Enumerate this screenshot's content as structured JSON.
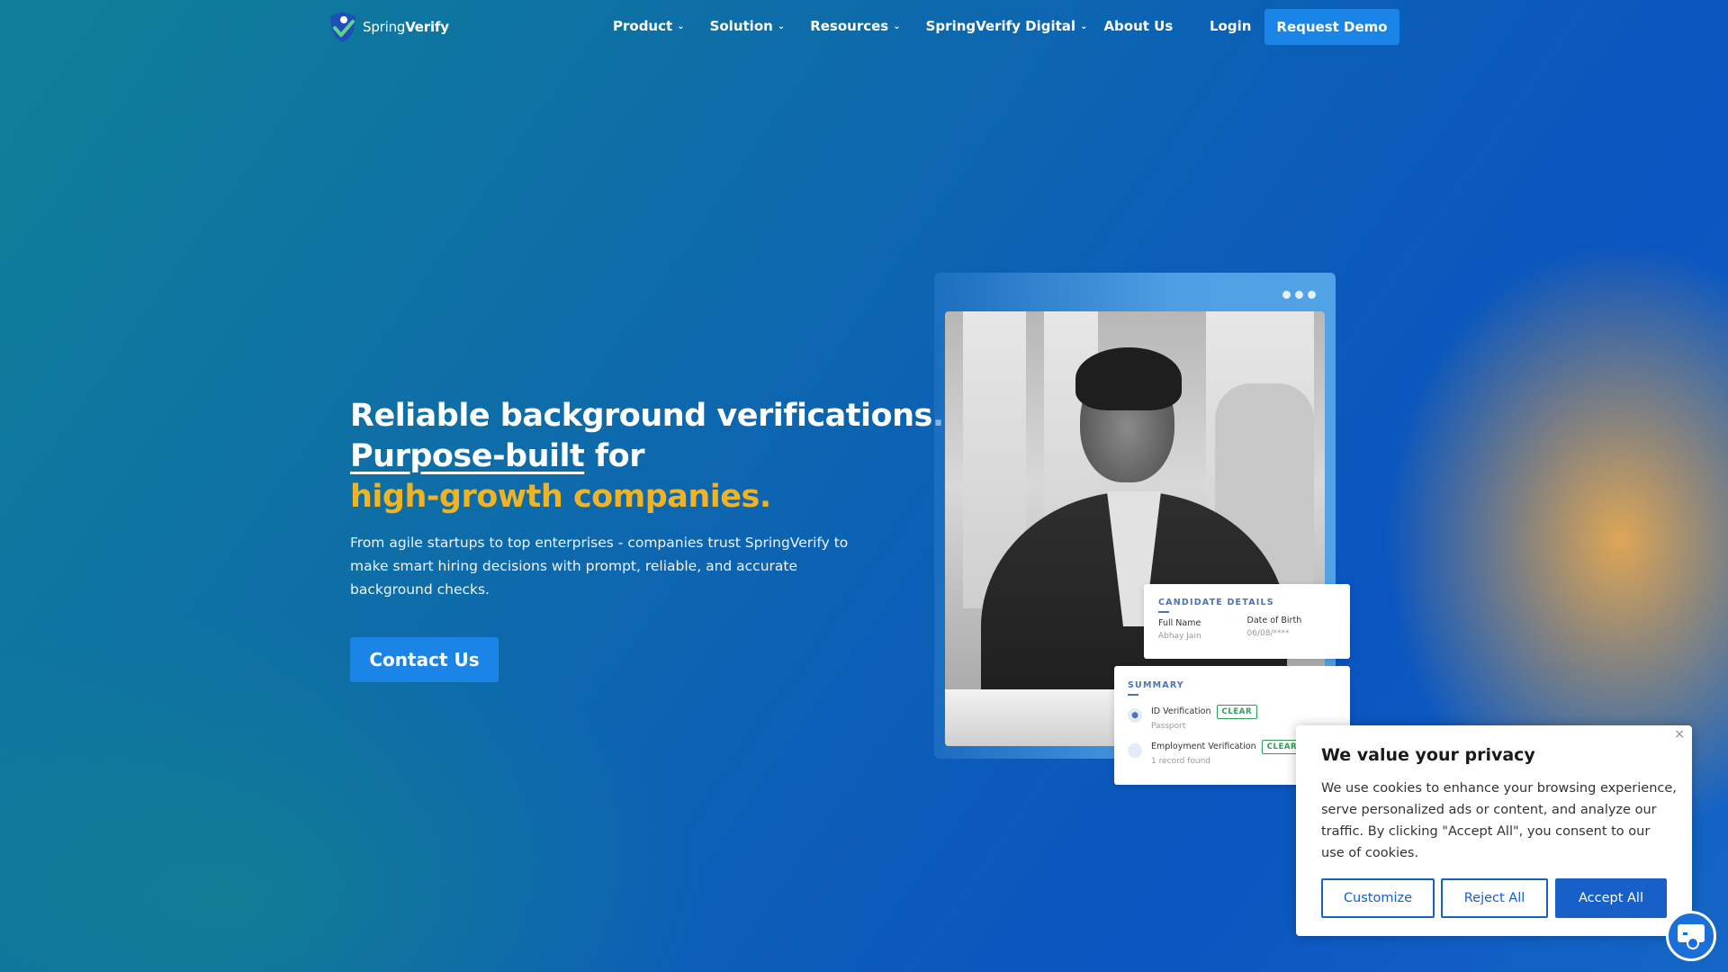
{
  "nav": {
    "logo_text_light": "Spring",
    "logo_text_bold": "Verify",
    "menu": [
      {
        "label": "Product",
        "has_dropdown": true
      },
      {
        "label": "Solution",
        "has_dropdown": true
      },
      {
        "label": "Resources",
        "has_dropdown": true
      },
      {
        "label": "SpringVerify Digital",
        "has_dropdown": true
      },
      {
        "label": "About Us",
        "has_dropdown": false
      }
    ],
    "login": "Login",
    "demo_button": "Request Demo"
  },
  "hero": {
    "line1": "Reliable background verifications.",
    "line2_underlined": "Purpose-built",
    "line2_rest": " for",
    "line3": "high-growth companies.",
    "description": "From agile startups to top enterprises - companies trust SpringVerify to make smart hiring decisions with prompt, reliable, and accurate background checks.",
    "cta": "Contact Us"
  },
  "candidate_card": {
    "title": "CANDIDATE DETAILS",
    "full_name_label": "Full Name",
    "full_name_value": "Abhay Jain",
    "dob_label": "Date of Birth",
    "dob_value": "06/08/****"
  },
  "summary_card": {
    "title": "SUMMARY",
    "rows": [
      {
        "label": "ID Verification",
        "sub": "Passport",
        "status": "CLEAR"
      },
      {
        "label": "Employment Verification",
        "sub": "1 record found",
        "status": "CLEAR"
      }
    ]
  },
  "cookie": {
    "title": "We value your privacy",
    "text": "We use cookies to enhance your browsing experience, serve personalized ads or content, and analyze our traffic. By clicking \"Accept All\", you consent to our use of cookies.",
    "customize": "Customize",
    "reject": "Reject All",
    "accept": "Accept All",
    "close": "×"
  },
  "colors": {
    "accent_yellow": "#f0b324",
    "button_blue": "#1b84e7",
    "cookie_blue": "#1660c8",
    "badge_green": "#2e9d55"
  }
}
